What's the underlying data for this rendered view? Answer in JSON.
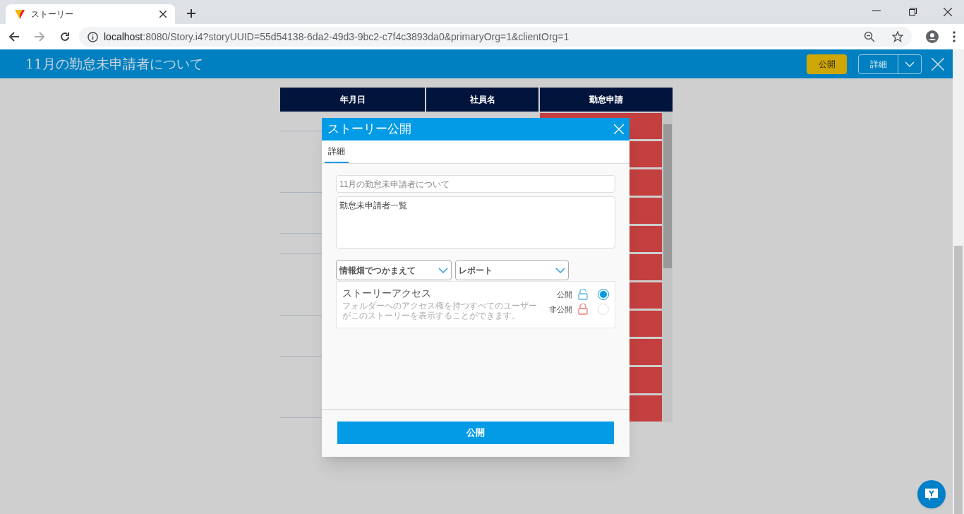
{
  "browser": {
    "tab_title": "ストーリー",
    "url_host": "localhost",
    "url_path": ":8080/Story.i4?storyUUID=55d54138-6da2-49d3-9bc2-c7f4c3893da0&primaryOrg=1&clientOrg=1"
  },
  "header": {
    "title": "11月の勤怠未申請者について",
    "publish_button": "公開",
    "details_button": "詳細"
  },
  "table": {
    "columns": [
      "年月日",
      "社員名",
      "勤怠申請"
    ]
  },
  "dialog": {
    "title": "ストーリー公開",
    "tabs": [
      {
        "label": "詳細",
        "selected": true
      }
    ],
    "title_field": {
      "placeholder": "11月の勤怠未申請者について"
    },
    "description_field": {
      "value": "勤怠未申請者一覧"
    },
    "folder_select": "情報畑でつかまえて",
    "type_select": "レポート",
    "access": {
      "heading": "ストーリーアクセス",
      "description": "フォルダーへのアクセス権を持つすべてのユーザーがこのストーリーを表示することができます。",
      "options": [
        {
          "label": "公開",
          "kind": "unlocked",
          "selected": true
        },
        {
          "label": "非公開",
          "kind": "locked",
          "selected": false
        }
      ]
    },
    "submit_button": "公開"
  }
}
